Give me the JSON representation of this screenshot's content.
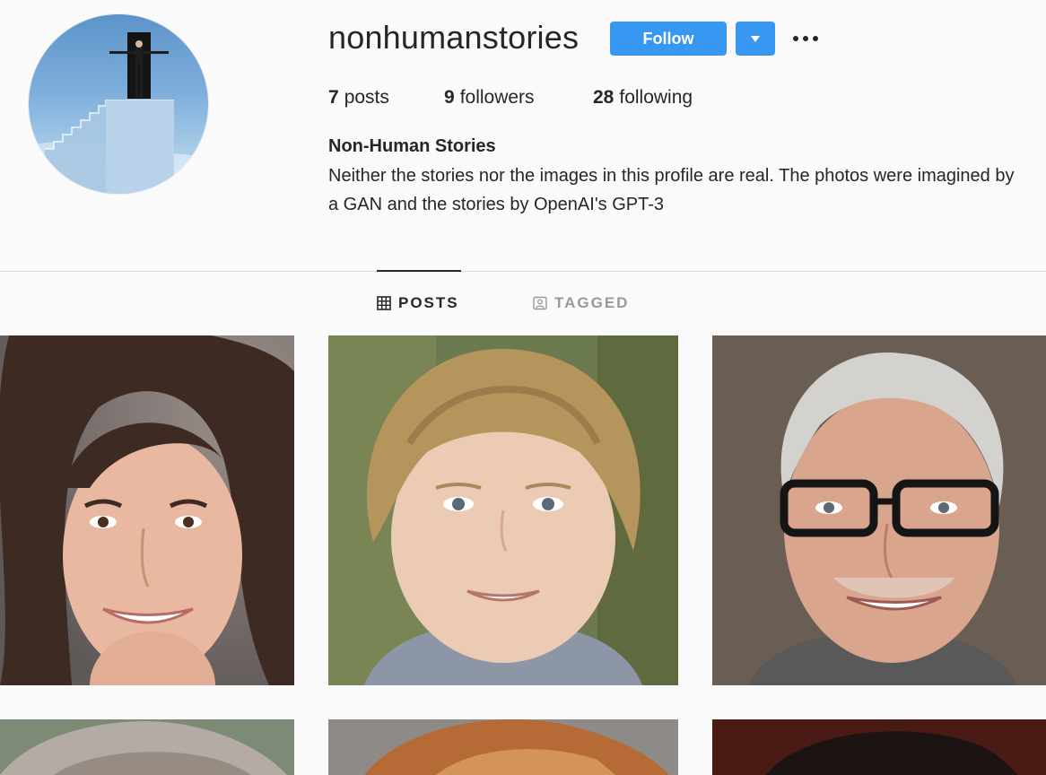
{
  "profile": {
    "username": "nonhumanstories",
    "full_name": "Non-Human Stories",
    "bio": "Neither the stories nor the images in this profile are real. The photos were imagined by a GAN and the stories by OpenAI's GPT-3",
    "avatar_icon": "profile-picture"
  },
  "actions": {
    "follow_label": "Follow",
    "dropdown_icon": "caret-down-icon",
    "more_icon": "ellipsis-icon"
  },
  "stats": {
    "posts_count": "7",
    "posts_label": "posts",
    "followers_count": "9",
    "followers_label": "followers",
    "following_count": "28",
    "following_label": "following"
  },
  "tabs": [
    {
      "label": "POSTS",
      "icon": "grid-icon",
      "active": true
    },
    {
      "label": "TAGGED",
      "icon": "tagged-user-icon",
      "active": false
    }
  ],
  "colors": {
    "accent": "#3897f0",
    "text": "#262626",
    "muted": "#999999",
    "background": "#fafafa",
    "divider": "#dbdbdb"
  },
  "posts": [
    {
      "subject": "smiling young woman with long brown hair"
    },
    {
      "subject": "young boy with curly blond hair"
    },
    {
      "subject": "smiling grey-haired man with glasses"
    },
    {
      "subject": "person with grey hair (partially visible)"
    },
    {
      "subject": "person with reddish hair (partially visible)"
    },
    {
      "subject": "person with dark hair (partially visible)"
    }
  ]
}
